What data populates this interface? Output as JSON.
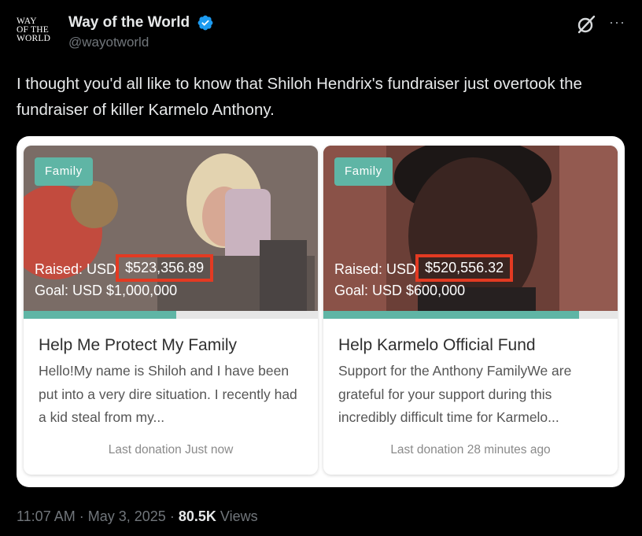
{
  "author": {
    "logo_lines": [
      "WAY",
      "OF THE",
      "WORLD"
    ],
    "display_name": "Way of the World",
    "handle": "@wayotworld",
    "verified": true
  },
  "tweet": {
    "text": "I thought you'd all like to know that Shiloh Hendrix's fundraiser just overtook the fundraiser of killer Karmelo Anthony."
  },
  "fundraisers": [
    {
      "tag": "Family",
      "raised_label": "Raised: USD",
      "raised_amount": "$523,356.89",
      "goal_text": "Goal: USD $1,000,000",
      "progress_fraction": 0.52,
      "title": "Help Me Protect My Family",
      "description": "Hello!My name is Shiloh and I have been put into a very dire situation. I recently had a kid steal from my...",
      "last_donation": "Last donation Just now"
    },
    {
      "tag": "Family",
      "raised_label": "Raised: USD",
      "raised_amount": "$520,556.32",
      "goal_text": "Goal: USD $600,000",
      "progress_fraction": 0.87,
      "title": "Help Karmelo Official Fund",
      "description": "Support for the Anthony FamilyWe are grateful for your support during this incredibly difficult time for Karmelo...",
      "last_donation": "Last donation 28 minutes ago"
    }
  ],
  "meta": {
    "time": "11:07 AM",
    "separator": "·",
    "date": "May 3, 2025",
    "views_count": "80.5K",
    "views_label": "Views"
  },
  "icons": {
    "verified": "verified-badge-icon",
    "grok": "grok-icon",
    "more": "more-dots-icon"
  },
  "colors": {
    "accent_teal": "#5fb5a5",
    "highlight_red": "#e33a22",
    "verified_blue": "#1d9bf0"
  }
}
